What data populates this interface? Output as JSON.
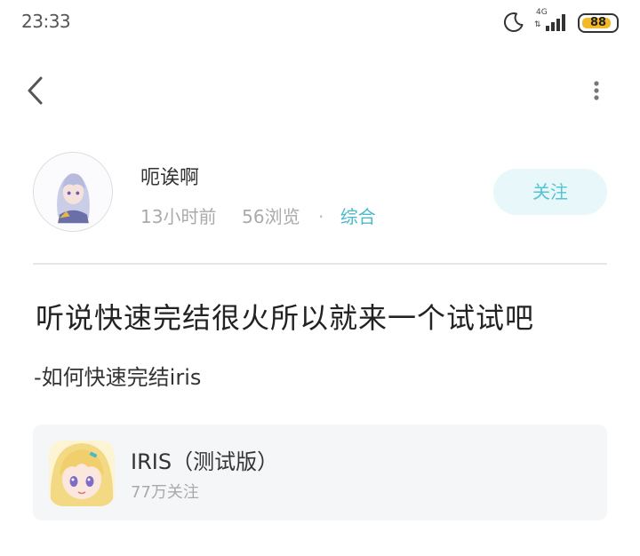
{
  "status_bar": {
    "time": "23:33",
    "network_type": "4G",
    "network_sub": "⇅",
    "battery": "88",
    "battery_level": 0.88,
    "icons": [
      "moon-icon",
      "signal-icon",
      "battery-icon"
    ]
  },
  "nav": {
    "back_icon": "chevron-left-icon",
    "more_icon": "vertical-dots-icon"
  },
  "author": {
    "name": "呃诶啊",
    "time_ago": "13小时前",
    "views": "56浏览",
    "separator": "·",
    "category": "综合",
    "follow_label": "关注"
  },
  "post": {
    "title": "听说快速完结很火所以就来一个试试吧",
    "body": "-如何快速完结iris"
  },
  "game_card": {
    "name": "IRIS（测试版）",
    "followers": "77万关注"
  },
  "colors": {
    "accent": "#49b9c9",
    "follow_bg": "#e8f7f9",
    "card_bg": "#f5f6f8",
    "battery": "#f4b928"
  }
}
